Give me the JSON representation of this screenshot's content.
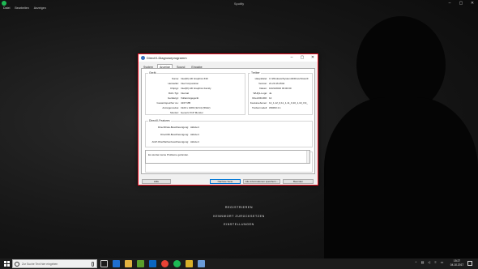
{
  "app": {
    "title": "Spotify",
    "menu": [
      "Datei",
      "Bearbeiten",
      "Anzeigen"
    ]
  },
  "window_controls": {
    "minimize": "–",
    "maximize": "▢",
    "close": "✕"
  },
  "dialog": {
    "title": "DirectX-Diagnoseprogramm",
    "controls": {
      "minimize": "–",
      "maximize": "▢",
      "close": "✕"
    },
    "tabs": [
      "System",
      "Anzeige",
      "Sound",
      "Eingabe"
    ],
    "active_tab": "Anzeige",
    "device": {
      "group_label": "Gerät",
      "rows": [
        {
          "key": "Name:",
          "value": "Intel(R) HD Graphics 630"
        },
        {
          "key": "Hersteller:",
          "value": "Intel Corporation"
        },
        {
          "key": "Chiptyp:",
          "value": "Intel(R) HD Graphics Family"
        },
        {
          "key": "DAC-Typ:",
          "value": "Internal"
        },
        {
          "key": "Gerätetyp:",
          "value": "Vollanzeigegerät"
        },
        {
          "key": "Gesamtspeicher ca.:",
          "value": "4167 MB"
        },
        {
          "key": "Anzeigemodus:",
          "value": "1920 x 1080 (32 bit) (59Hz)"
        },
        {
          "key": "Monitor:",
          "value": "Generic PnP Monitor"
        }
      ]
    },
    "drivers": {
      "group_label": "Treiber",
      "rows": [
        {
          "key": "Hauptdatei:",
          "value": "C:\\Windows\\System32\\DriverStore\\F"
        },
        {
          "key": "Version:",
          "value": "21.20.16.4542"
        },
        {
          "key": "Datum:",
          "value": "10/24/2016 03:00:00"
        },
        {
          "key": "WHQL-Logo:",
          "value": "Ja"
        },
        {
          "key": "Direct3D-DDI:",
          "value": "12"
        },
        {
          "key": "Featureebenen:",
          "value": "12_1,12_0,11_1,11_0,10_1,10_0,9_"
        },
        {
          "key": "Treibermodell:",
          "value": "WDDM 2.1"
        }
      ]
    },
    "features": {
      "group_label": "DirectX-Features",
      "rows": [
        {
          "key": "DirectDraw-Beschleunigung:",
          "value": "Aktiviert"
        },
        {
          "key": "Direct3D-Beschleunigung:",
          "value": "Aktiviert"
        },
        {
          "key": "AGP-Oberflächenbeschleunigung:",
          "value": "Aktiviert"
        }
      ]
    },
    "notes": {
      "group_label": "Hinweise",
      "line": "Es wurden keine Probleme gefunden."
    },
    "buttons": {
      "help": "Hilfe",
      "next_page": "Nächste Seite",
      "save_info": "Alle Informationen speichern...",
      "exit": "Beenden"
    }
  },
  "lock_options": [
    "REGISTRIEREN",
    "KENNWORT ZURÜCKSETZEN",
    "EINSTELLUNGEN"
  ],
  "taskbar": {
    "search_placeholder": "Zur Suche Text hier eingeben",
    "clock_time": "15:27",
    "clock_date": "04.10.2017"
  }
}
